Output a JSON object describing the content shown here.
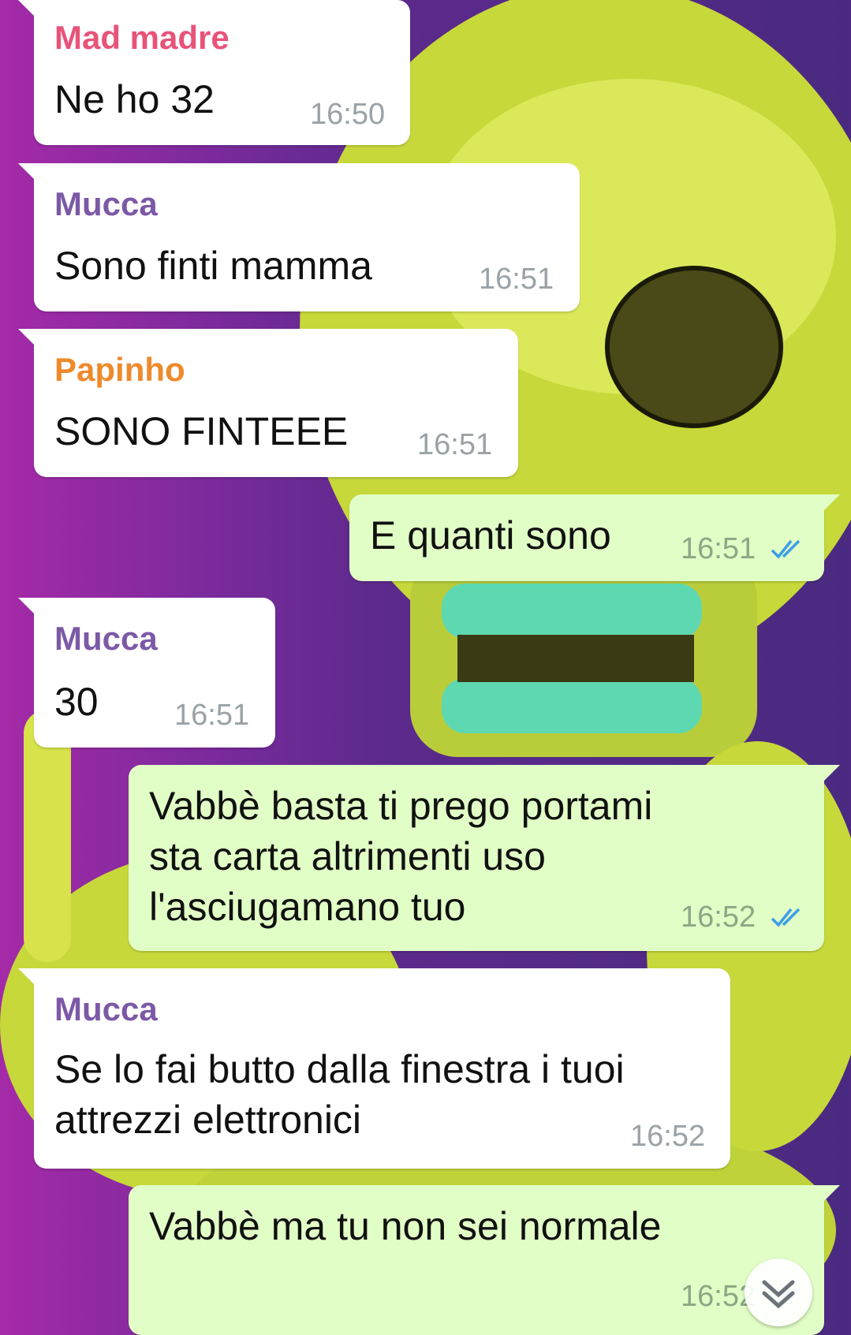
{
  "colors": {
    "incoming_bubble": "#ffffff",
    "outgoing_bubble": "#e1fec6",
    "name_mad_madre": "#e8537a",
    "name_mucca": "#7c59a6",
    "name_papinho": "#ee8a2c",
    "read_ticks": "#3d9ee8"
  },
  "messages": [
    {
      "sender": "Mad madre",
      "text": "Ne ho 32",
      "time": "16:50"
    },
    {
      "sender": "Mucca",
      "text": "Sono finti mamma",
      "time": "16:51"
    },
    {
      "sender": "Papinho",
      "text": "SONO FINTEEE",
      "time": "16:51"
    },
    {
      "text": "E quanti sono",
      "time": "16:51",
      "status": "read-double-check-icon"
    },
    {
      "sender": "Mucca",
      "text": "30",
      "time": "16:51"
    },
    {
      "text": "Vabbè basta ti prego portami\nsta carta altrimenti uso\nl'asciugamano tuo",
      "time": "16:52",
      "status": "read-double-check-icon"
    },
    {
      "sender": "Mucca",
      "text": "Se lo fai butto dalla finestra i tuoi\nattrezzi elettronici",
      "time": "16:52"
    },
    {
      "text": "Vabbè ma tu non sei normale",
      "time": "16:52",
      "status": "read-double-check-icon"
    }
  ],
  "scroll_button": {
    "icon": "chevron-double-down-icon"
  }
}
